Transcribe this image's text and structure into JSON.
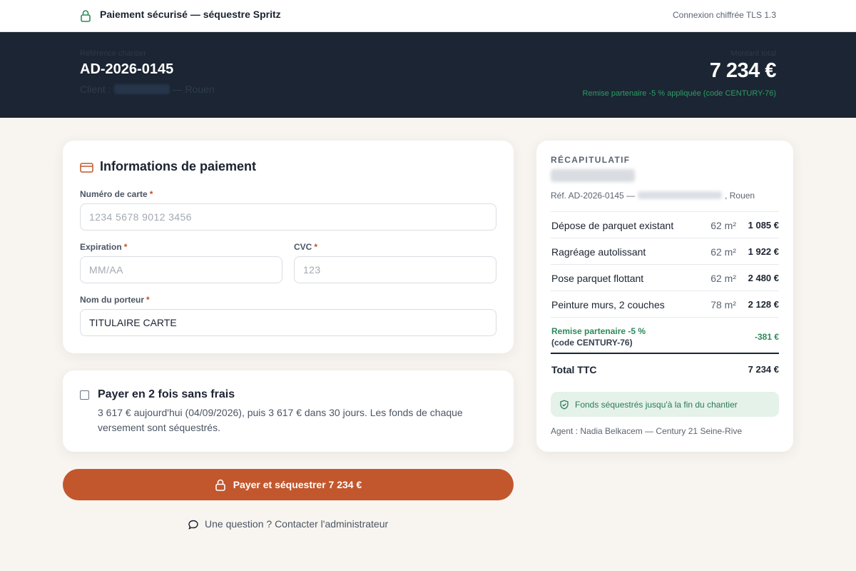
{
  "topbar": {
    "icon": "lock-icon",
    "title": "Paiement sécurisé — séquestre Spritz",
    "tls": "Connexion chiffrée TLS 1.3"
  },
  "banner": {
    "ref_label": "Référence chantier",
    "ref_value": "AD-2026-0145",
    "client_prefix": "Client :",
    "client_city": "— Rouen",
    "amount_label": "Montant total",
    "amount_value": "7 234 €",
    "discount_note": "Remise partenaire -5 % appliquée (code CENTURY-76)"
  },
  "payment": {
    "icon": "credit-card-icon",
    "title": "Informations de paiement",
    "card_number": {
      "label": "Numéro de carte",
      "required": "*",
      "placeholder": "1234 5678 9012 3456",
      "value": ""
    },
    "expiration": {
      "label": "Expiration",
      "required": "*",
      "placeholder": "MM/AA",
      "value": ""
    },
    "cvc": {
      "label": "CVC",
      "required": "*",
      "placeholder": "123",
      "value": ""
    },
    "holder": {
      "label": "Nom du porteur",
      "required": "*",
      "placeholder": "",
      "value": "TITULAIRE CARTE"
    }
  },
  "split": {
    "checked": false,
    "title": "Payer en 2 fois sans frais",
    "description": "3 617 € aujourd'hui (04/09/2026), puis 3 617 € dans 30 jours. Les fonds de chaque versement sont séquestrés."
  },
  "pay_button": {
    "icon": "lock-icon",
    "label": "Payer et séquestrer 7 234 €"
  },
  "contact": {
    "icon": "chat-bubble-icon",
    "label": "Une question ? Contacter l'administrateur"
  },
  "recap": {
    "title": "RÉCAPITULATIF",
    "ref_prefix": "Réf. AD-2026-0145 —",
    "ref_suffix": ", Rouen",
    "items": [
      {
        "label": "Dépose de parquet existant",
        "qty": "62 m²",
        "amount": "1 085 €"
      },
      {
        "label": "Ragréage autolissant",
        "qty": "62 m²",
        "amount": "1 922 €"
      },
      {
        "label": "Pose parquet flottant",
        "qty": "62 m²",
        "amount": "2 480 €"
      },
      {
        "label": "Peinture murs, 2 couches",
        "qty": "78 m²",
        "amount": "2 128 €"
      }
    ],
    "discount": {
      "line1": "Remise partenaire -5 %",
      "line2": "(code CENTURY-76)",
      "amount": "-381 €"
    },
    "total": {
      "label": "Total TTC",
      "amount": "7 234 €"
    },
    "escrow": {
      "icon": "shield-check-icon",
      "label": "Fonds séquestrés jusqu'à la fin du chantier"
    },
    "agent": "Agent : Nadia Belkacem — Century 21 Seine-Rive"
  },
  "colors": {
    "accent": "#c2572d",
    "banner": "#1b2533",
    "success": "#2c8a5a",
    "background": "#f8f5f0"
  }
}
